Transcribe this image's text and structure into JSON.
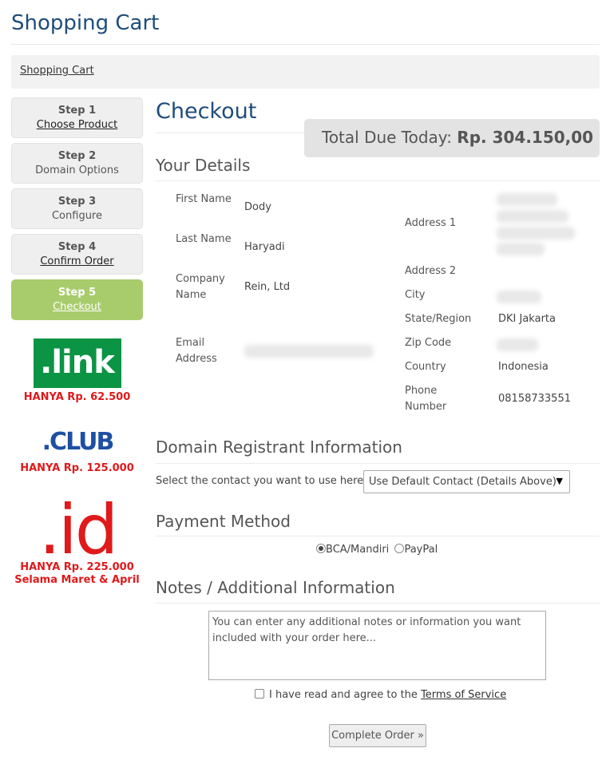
{
  "header": {
    "title": "Shopping Cart"
  },
  "breadcrumb": {
    "item": "Shopping Cart"
  },
  "steps": [
    {
      "num": "Step 1",
      "label": "Choose Product"
    },
    {
      "num": "Step 2",
      "label": "Domain Options"
    },
    {
      "num": "Step 3",
      "label": "Configure"
    },
    {
      "num": "Step 4",
      "label": "Confirm Order"
    },
    {
      "num": "Step 5",
      "label": "Checkout"
    }
  ],
  "promos": [
    {
      "logo": ".link",
      "text": "HANYA Rp. 62.500"
    },
    {
      "logo": ".CLUB",
      "text": "HANYA Rp. 125.000"
    },
    {
      "logo": ".id",
      "text": "HANYA Rp. 225.000",
      "text2": "Selama Maret & April"
    }
  ],
  "checkout": {
    "title": "Checkout",
    "total_label": "Total Due Today:",
    "total_value": "Rp. 304.150,00"
  },
  "details": {
    "heading": "Your Details",
    "first_name_label": "First Name",
    "first_name": "Dody",
    "last_name_label": "Last Name",
    "last_name": "Haryadi",
    "company_label": "Company Name",
    "company": "Rein, Ltd",
    "email_label": "Email Address",
    "address1_label": "Address 1",
    "address2_label": "Address 2",
    "city_label": "City",
    "state_label": "State/Region",
    "state": "DKI Jakarta",
    "zip_label": "Zip Code",
    "country_label": "Country",
    "country": "Indonesia",
    "phone_label": "Phone Number",
    "phone": "08158733551"
  },
  "registrant": {
    "heading": "Domain Registrant Information",
    "prompt": "Select the contact you want to use here:",
    "selected": "Use Default Contact (Details Above)"
  },
  "payment": {
    "heading": "Payment Method",
    "option1": "BCA/Mandiri",
    "option2": "PayPal"
  },
  "notes": {
    "heading": "Notes / Additional Information",
    "placeholder": "You can enter any additional notes or information you want included with your order here..."
  },
  "tos": {
    "text": "I have read and agree to the ",
    "link": "Terms of Service"
  },
  "submit": {
    "label": "Complete Order »"
  },
  "colors": {
    "accent": "#1e4d7b",
    "active_step": "#a8cc6c",
    "promo_red": "#e0191b",
    "link_green": "#0b9444"
  }
}
